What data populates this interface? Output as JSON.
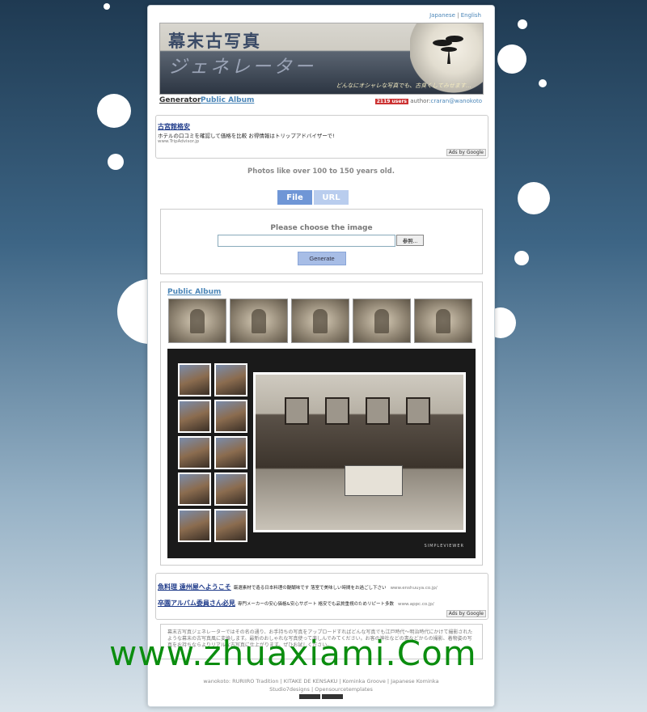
{
  "header": {
    "lang_japanese": "Japanese",
    "lang_sep": " | ",
    "lang_english": "English",
    "banner_title_1": "幕末古写真",
    "banner_title_2": "ジェネレーター",
    "banner_sub": "どんなにオシャレな写真でも、古臭くしてみせます…"
  },
  "nav": {
    "generator": "Generator",
    "public_album": "Public Album",
    "user_count": "2119 users",
    "author_label": "author:",
    "author_link": "craran@wanokoto"
  },
  "ad_top": {
    "title": "古宮館格安",
    "text": "ホテルの口コミを確認して価格を比較 お得情報はトリップアドバイザーで!",
    "url": "www.TripAdvisor.jp",
    "ads_by": "Ads by Google"
  },
  "tagline": "Photos like over 100 to 150 years old.",
  "tabs": {
    "file": "File",
    "url": "URL"
  },
  "upload": {
    "prompt": "Please choose the image",
    "browse": "参照...",
    "generate": "Generate"
  },
  "album": {
    "title": "Public Album",
    "viewer_logo": "SIMPLEVIEWER"
  },
  "ad_bottom": {
    "items": [
      {
        "title": "魚料理 遠州屋へようこそ",
        "text": "厳選素材で造る日本料理の醍醐味です 落室で美味しい時間をお過ごし下さい",
        "url": "www.enshuuya.co.jp/"
      },
      {
        "title": "卒園アルバム委員さん必見",
        "text": "専門メーカーの安心価格&安心サポート 格安でも品質重視のためリピート多数",
        "url": "www.appc.co.jp/"
      }
    ],
    "ads_by": "Ads by Google"
  },
  "description": "幕末古写真ジェネレーターではその名の通り、お手持ちの写真をアップロードすればどんな写真でも江戸時代〜明治時代にかけて撮影されたような幕末の古写真風に変換します。最新のおしゃれな写真使って楽しんでみてください。お客の神社などの書などからの撮影、着物姿の写真をお持ちならよりリアルな古写真に仕上がります。ぜひお試しください。",
  "footer": {
    "line1": "wanokoto: RURIIRO Tradition | KITAKE DE KENSAKU | Kominka Groove | Japanese Kominka",
    "line2": "Studio7designs | Opensourcetemplates"
  },
  "watermark": "www.zhuaxiami.Com",
  "colors": {
    "accent": "#4b86b8",
    "tab_active": "#6f96d6",
    "tab_inactive": "#b9cdee",
    "watermark": "#0b8d0f"
  }
}
